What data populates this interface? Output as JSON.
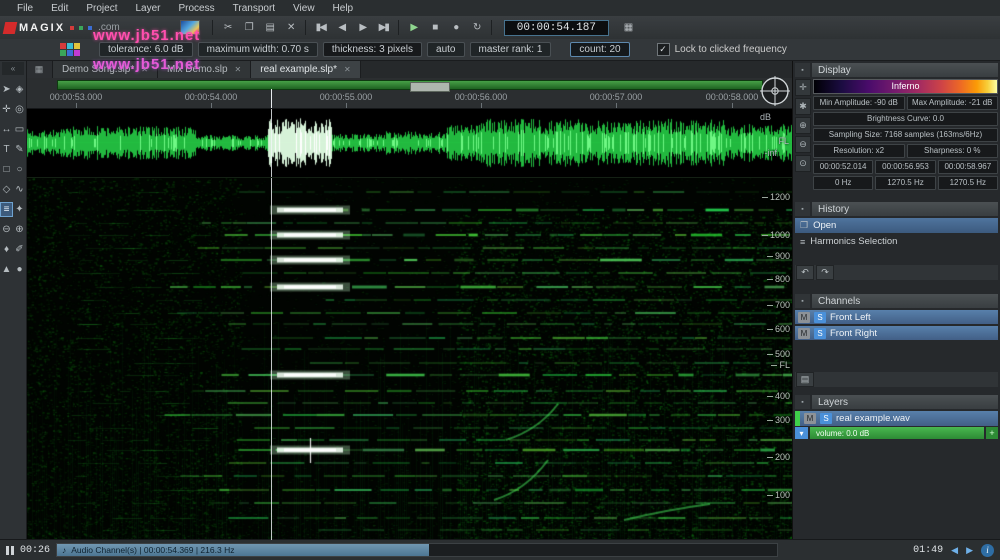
{
  "app": {
    "watermark": "www.jb51.net"
  },
  "ui": {
    "collapse": "▪",
    "close": "✕",
    "check": "✓",
    "note": "♪",
    "undo": "↶",
    "redo": "↷",
    "prev": "◀",
    "next": "▶",
    "info": "i",
    "left_collapse": "«"
  },
  "menubar": {
    "items": [
      "File",
      "Edit",
      "Project",
      "Layer",
      "Process",
      "Transport",
      "View",
      "Help"
    ]
  },
  "brand": {
    "name": "MAGIX",
    "suffix": ".com"
  },
  "toolbar": {
    "time": "00:00:54.187",
    "grid_glyph": "▦",
    "buttons": [
      {
        "name": "cut-button",
        "glyph": "✂"
      },
      {
        "name": "copy-button",
        "glyph": "❐"
      },
      {
        "name": "paste-button",
        "glyph": "▤"
      },
      {
        "name": "delete-button",
        "glyph": "✕"
      },
      {
        "sep": true
      },
      {
        "name": "skip-start-button",
        "glyph": "▮◀"
      },
      {
        "name": "step-back-button",
        "glyph": "◀"
      },
      {
        "name": "step-forward-button",
        "glyph": "▶"
      },
      {
        "name": "skip-end-button",
        "glyph": "▶▮"
      },
      {
        "sep": true
      },
      {
        "name": "play-button",
        "glyph": "▶",
        "color": "#8fd68f"
      },
      {
        "name": "stop-button",
        "glyph": "■"
      },
      {
        "name": "record-button",
        "glyph": "●"
      },
      {
        "name": "loop-button",
        "glyph": "↻"
      },
      {
        "sep": true
      }
    ]
  },
  "params": {
    "tolerance": "tolerance: 6.0 dB",
    "max_width": "maximum width: 0.70 s",
    "thickness": "thickness: 3 pixels",
    "auto": "auto",
    "master_rank": "master rank: 1",
    "count": "count: 20",
    "lock_checkbox": "Lock to clicked frequency"
  },
  "tabs": {
    "items": [
      {
        "label": "Demo Song.slp*"
      },
      {
        "label": "Mix Demo.slp"
      },
      {
        "label": "real example.slp*"
      }
    ]
  },
  "ruler": {
    "ticks": [
      {
        "label": "00:00:53.000",
        "pos": 50
      },
      {
        "label": "00:00:54.000",
        "pos": 185
      },
      {
        "label": "00:00:55.000",
        "pos": 320
      },
      {
        "label": "00:00:56.000",
        "pos": 455
      },
      {
        "label": "00:00:57.000",
        "pos": 590
      },
      {
        "label": "00:00:58.000",
        "pos": 706
      }
    ]
  },
  "wave_scale": {
    "db": "dB",
    "neg_inf": "-inf",
    "channel": "FL"
  },
  "freq_scale": {
    "channel": "FL",
    "ticks": [
      {
        "label": "1200",
        "pos": 14
      },
      {
        "label": "1000",
        "pos": 52
      },
      {
        "label": "900",
        "pos": 73
      },
      {
        "label": "800",
        "pos": 96
      },
      {
        "label": "700",
        "pos": 122
      },
      {
        "label": "600",
        "pos": 146
      },
      {
        "label": "500",
        "pos": 171
      },
      {
        "label": "400",
        "pos": 213
      },
      {
        "label": "300",
        "pos": 237
      },
      {
        "label": "200",
        "pos": 274
      },
      {
        "label": "100",
        "pos": 312
      }
    ]
  },
  "left_toolbar": {
    "tools": [
      {
        "name": "select-tool",
        "glyph": "➤"
      },
      {
        "name": "transform-tool",
        "glyph": "◈"
      },
      {
        "name": "hand-tool",
        "glyph": "✛"
      },
      {
        "name": "zoom-tool",
        "glyph": "◎"
      },
      {
        "name": "move-tool",
        "glyph": "↔"
      },
      {
        "name": "frame-tool",
        "glyph": "▭"
      },
      {
        "name": "text-tool",
        "glyph": "T"
      },
      {
        "name": "pencil-tool",
        "glyph": "✎"
      },
      {
        "name": "rect-select-tool",
        "glyph": "□"
      },
      {
        "name": "lasso-select-tool",
        "glyph": "○"
      },
      {
        "name": "brush-select-tool",
        "glyph": "◇"
      },
      {
        "name": "frequency-select-tool",
        "glyph": "∿"
      },
      {
        "name": "harmonics-select-tool",
        "glyph": "≡",
        "active": true
      },
      {
        "name": "magic-wand-tool",
        "glyph": "✦"
      },
      {
        "name": "eraser-tool",
        "glyph": "⊖"
      },
      {
        "name": "clone-tool",
        "glyph": "⊕"
      },
      {
        "name": "stamp-tool",
        "glyph": "♦"
      },
      {
        "name": "brush-tool",
        "glyph": "✐"
      },
      {
        "name": "pin-tool",
        "glyph": "▲"
      },
      {
        "name": "spray-tool",
        "glyph": "●"
      }
    ]
  },
  "display_panel": {
    "title": "Display",
    "colormap": "Inferno",
    "mini_tools": [
      {
        "name": "pan-view-button",
        "glyph": "✛"
      },
      {
        "name": "view-settings-button",
        "glyph": "✱"
      },
      {
        "name": "zoom-in-button",
        "glyph": "⊕"
      },
      {
        "name": "zoom-out-button",
        "glyph": "⊖"
      },
      {
        "name": "reset-view-button",
        "glyph": "⊙"
      }
    ],
    "min_amplitude": "Min Amplitude: -90 dB",
    "max_amplitude": "Max Amplitude: -21 dB",
    "brightness": "Brightness Curve: 0.0",
    "sampling": "Sampling Size: 7168 samples (163ms/6Hz)",
    "resolution": "Resolution: x2",
    "sharpness": "Sharpness: 0 %",
    "time_start": "00:00:52.014",
    "time_cursor": "00:00:56.953",
    "time_end": "00:00:58.967",
    "freq_low": "0 Hz",
    "freq_cursor": "1270.5 Hz",
    "freq_high": "1270.5 Hz"
  },
  "history_panel": {
    "title": "History",
    "items": [
      {
        "label": "Open",
        "glyph": "❐",
        "icon_name": "document-icon",
        "selected": true
      },
      {
        "label": "Harmonics Selection",
        "glyph": "≡",
        "icon_name": "harmonics-icon",
        "selected": false
      }
    ]
  },
  "channels_panel": {
    "title": "Channels",
    "mute": "M",
    "solo": "S",
    "items": [
      "Front Left",
      "Front Right"
    ],
    "footer_glyph": "▤"
  },
  "layers_panel": {
    "title": "Layers",
    "mute": "M",
    "solo": "S",
    "layer_name": "real example.wav",
    "volume": "volume: 0.0 dB",
    "options_glyph": "▾",
    "add_glyph": "+"
  },
  "statusbar": {
    "elapsed": "00:26",
    "total": "01:49",
    "info_text": "Audio Channel(s) | 00:00:54.369 | 216.3 Hz"
  }
}
